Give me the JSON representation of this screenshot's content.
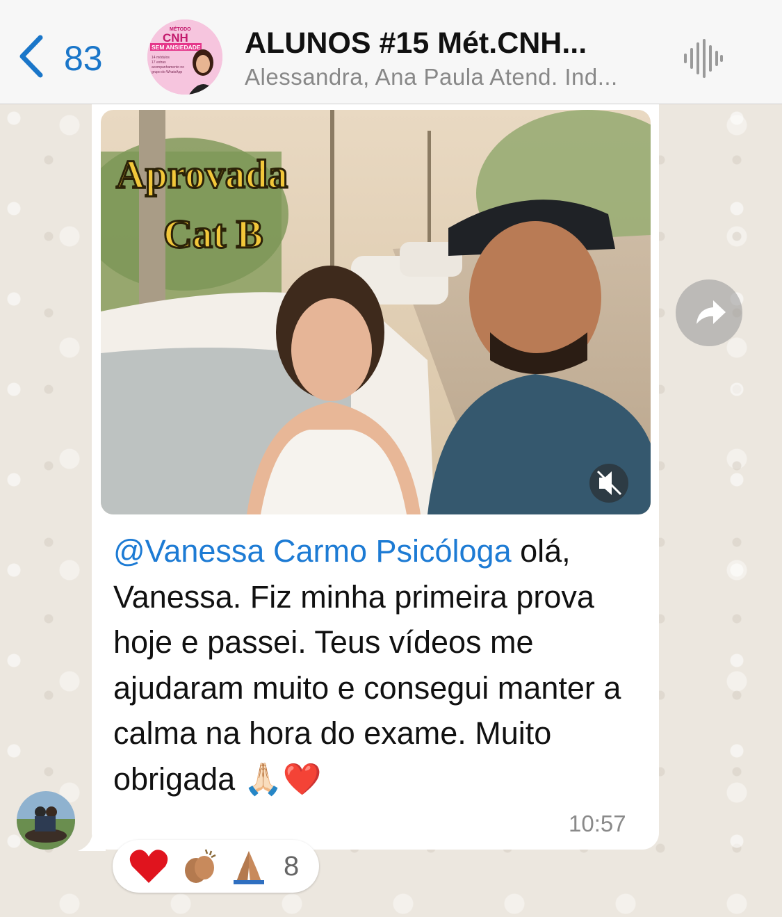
{
  "header": {
    "back_count": "83",
    "title": "ALUNOS #15 Mét.CNH...",
    "subtitle": "Alessandra, Ana Paula Atend. Ind...",
    "avatar_text": {
      "brand_small": "MÉTODO",
      "brand_big": "CNH",
      "brand_ribbon": "SEM ANSIEDADE",
      "lines": [
        "14 módulos",
        "17 extras",
        "acompanhamento no",
        "grupo do WhatsApp"
      ]
    }
  },
  "message": {
    "image_overlay_line1": "Aprovada",
    "image_overlay_line2": "Cat B",
    "mention": "@Vanessa Carmo Psicóloga",
    "text": "  olá, Vanessa. Fiz minha primeira prova hoje e passei. Teus vídeos me ajudaram muito e consegui manter a calma na hora do exame. Muito obrigada",
    "emojis": "🙏🏻❤️",
    "time": "10:57"
  },
  "reactions": {
    "emojis": [
      "heart",
      "clapping-hands",
      "praying-hands"
    ],
    "count": "8"
  },
  "colors": {
    "link": "#1d7bd4",
    "header_bg": "#f7f7f7",
    "wallpaper": "#ece7df",
    "title_gold": "#f2c73a"
  }
}
